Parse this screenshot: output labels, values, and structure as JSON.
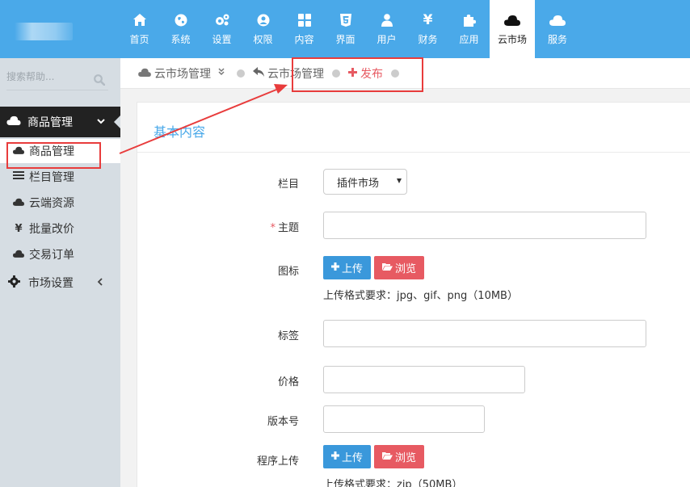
{
  "nav": {
    "items": [
      {
        "label": "首页",
        "icon": "home-icon"
      },
      {
        "label": "系统",
        "icon": "globe-icon"
      },
      {
        "label": "设置",
        "icon": "gears-icon"
      },
      {
        "label": "权限",
        "icon": "user-circle-icon"
      },
      {
        "label": "内容",
        "icon": "grid-icon"
      },
      {
        "label": "界面",
        "icon": "html5-icon"
      },
      {
        "label": "用户",
        "icon": "user-icon"
      },
      {
        "label": "财务",
        "icon": "yen-icon"
      },
      {
        "label": "应用",
        "icon": "puzzle-icon"
      },
      {
        "label": "云市场",
        "icon": "cloud-icon"
      },
      {
        "label": "服务",
        "icon": "cloud-icon"
      }
    ],
    "active_index": 9
  },
  "sidebar": {
    "search_placeholder": "搜索帮助...",
    "group_label": "商品管理",
    "items": [
      {
        "label": "商品管理",
        "icon": "cloud-icon"
      },
      {
        "label": "栏目管理",
        "icon": "list-icon"
      },
      {
        "label": "云端资源",
        "icon": "cloud-icon"
      },
      {
        "label": "批量改价",
        "icon": "yen-icon"
      },
      {
        "label": "交易订单",
        "icon": "cloud-icon"
      }
    ],
    "settings_label": "市场设置"
  },
  "breadcrumb": {
    "root": "云市场管理",
    "parent": "云市场管理",
    "current": "发布"
  },
  "form": {
    "section_title": "基本内容",
    "column_label": "栏目",
    "column_value": "插件市场",
    "subject_label": "主题",
    "required_mark": "*",
    "icon_label": "图标",
    "upload_label": "上传",
    "browse_label": "浏览",
    "icon_hint": "上传格式要求：jpg、gif、png（10MB）",
    "tag_label": "标签",
    "price_label": "价格",
    "version_label": "版本号",
    "program_label": "程序上传",
    "program_hint": "上传格式要求：zip（50MB）"
  },
  "colors": {
    "accent": "#4aa9e9",
    "danger": "#e75a62",
    "upload": "#3a98db",
    "sidebar": "#d6dde3",
    "annotation": "#e83c3c"
  }
}
